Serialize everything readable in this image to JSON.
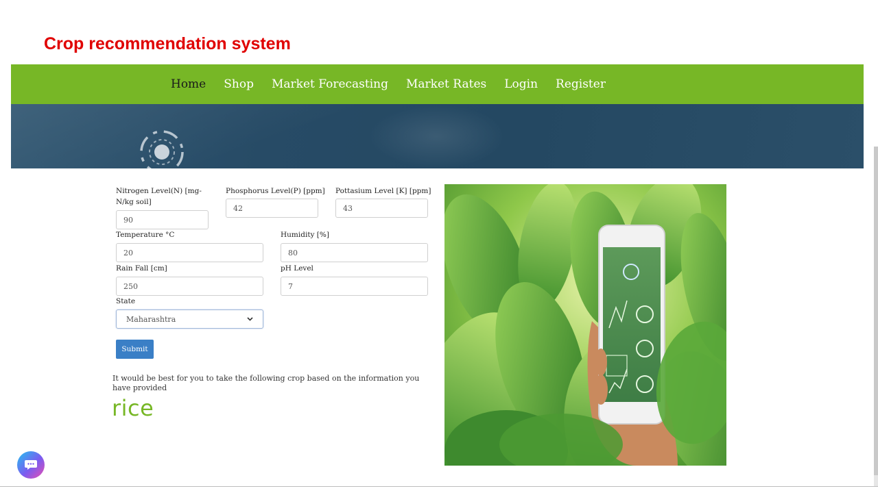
{
  "slide": {
    "title": "Crop recommendation system"
  },
  "nav": {
    "items": [
      "Home",
      "Shop",
      "Market Forecasting",
      "Market Rates",
      "Login",
      "Register"
    ],
    "active": "Home"
  },
  "form": {
    "nitrogen_label": "Nitrogen Level(N) [mg-N/kg soil]",
    "nitrogen_value": "90",
    "phosphorus_label": "Phosphorus Level(P) [ppm]",
    "phosphorus_value": "42",
    "potassium_label": "Pottasium Level [K] [ppm]",
    "potassium_value": "43",
    "temperature_label": "Temperature °C",
    "temperature_value": "20",
    "humidity_label": "Humidity [%]",
    "humidity_value": "80",
    "rainfall_label": "Rain Fall [cm]",
    "rainfall_value": "250",
    "ph_label": "pH Level",
    "ph_value": "7",
    "state_label": "State",
    "state_value": "Maharashtra",
    "submit_label": "Submit"
  },
  "result": {
    "message": "It would be best for you to take the following crop based on the information you have provided",
    "crop": "rice"
  },
  "colors": {
    "title": "#e00000",
    "navbar": "#77b726",
    "banner": "#274b66",
    "submit": "#3a7fc6",
    "crop": "#77b726"
  },
  "icons": {
    "banner": "sensor-logo-icon",
    "dropdown": "chevron-down-icon",
    "chat": "chat-bubble-icon"
  }
}
